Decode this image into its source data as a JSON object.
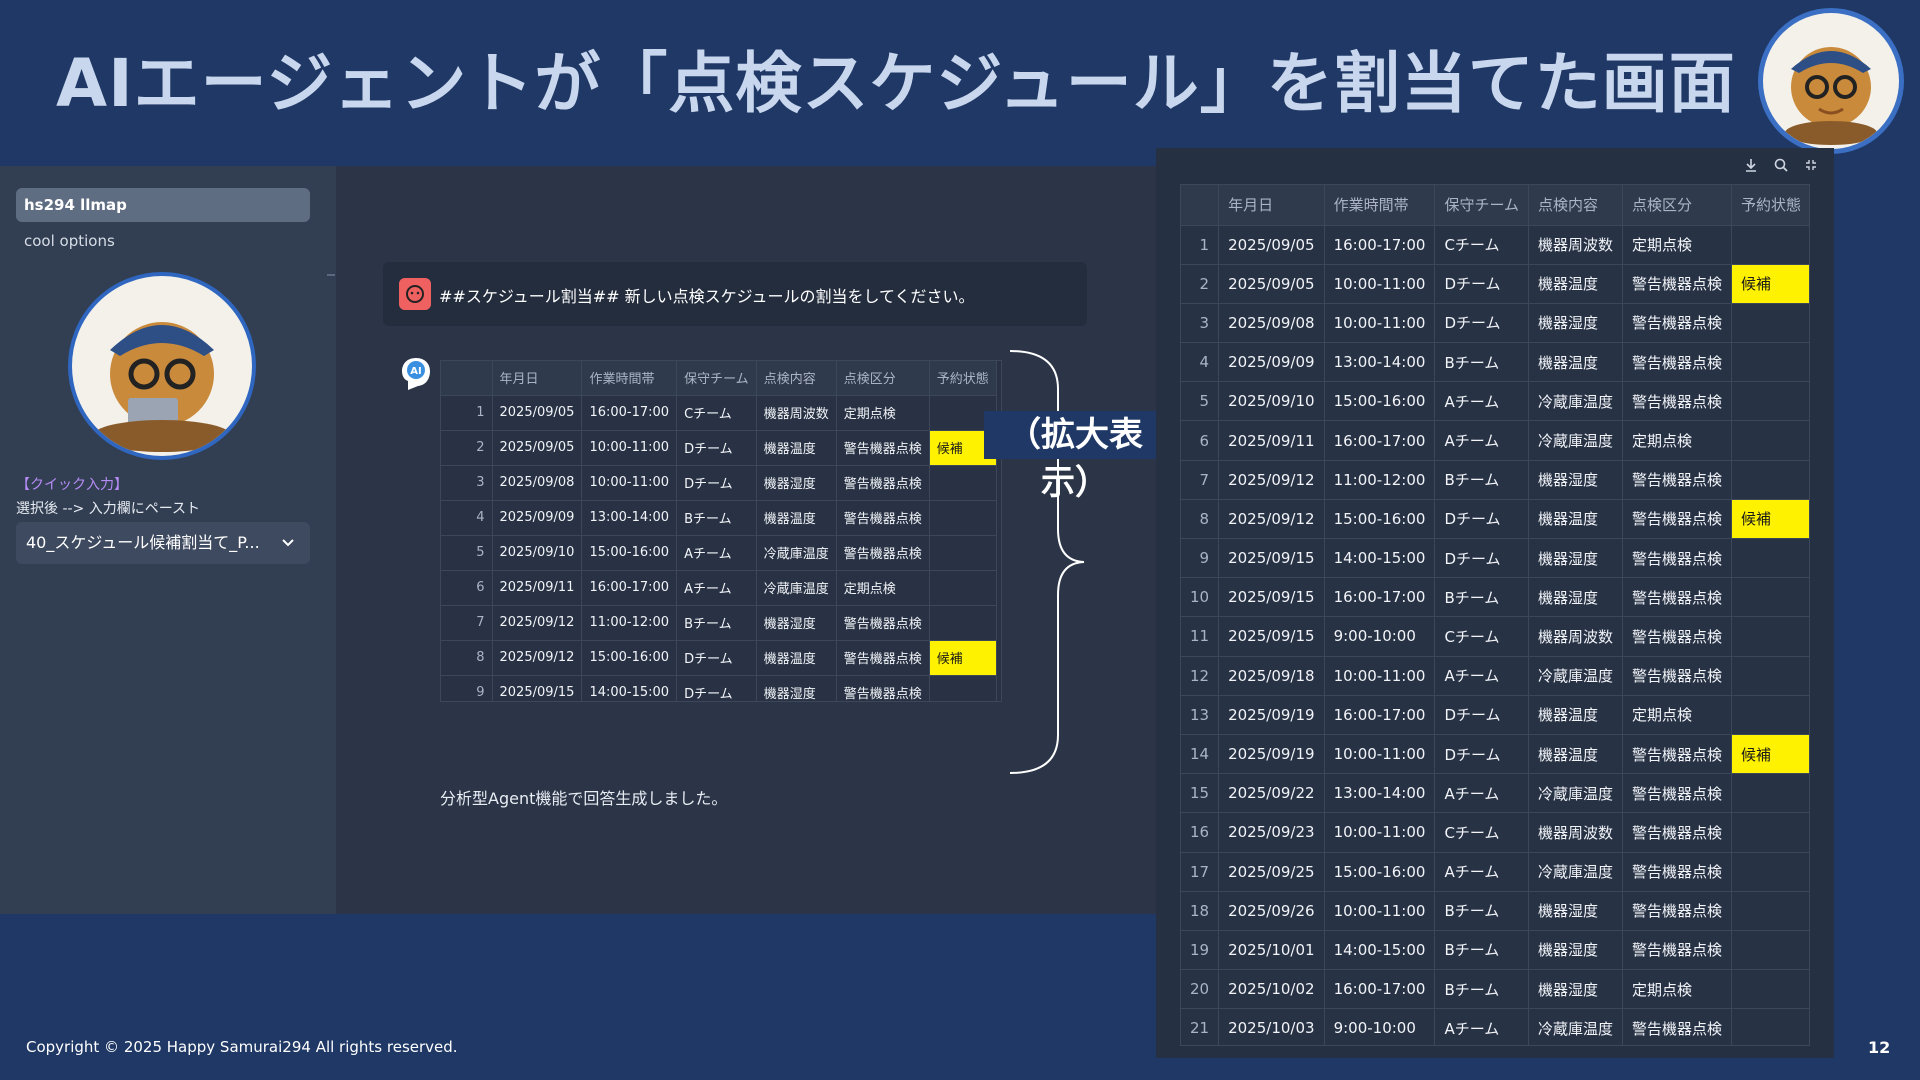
{
  "slide": {
    "title": "AIエージェントが「点検スケジュール」を割当てた画面",
    "copyright": "Copyright © 2025 Happy Samurai294 All rights reserved.",
    "page_number": "12",
    "zoom_label": "（拡大表示）"
  },
  "sidebar": {
    "model_select": "hs294 llmap",
    "options_link": "cool options",
    "quick_title": "【クイック入力】",
    "quick_hint": "選択後 --> 入力欄にペースト",
    "prompt_select": "40_スケジュール候補割当て_P..."
  },
  "chat": {
    "user_message": "##スケジュール割当## 新しい点検スケジュールの割当をしてください。",
    "ai_icon_label": "AI",
    "answer_text": "分析型Agent機能で回答生成しました。"
  },
  "table": {
    "columns": [
      "",
      "年月日",
      "作業時間帯",
      "保守チーム",
      "点検内容",
      "点検区分",
      "予約状態"
    ],
    "rows": [
      [
        "1",
        "2025/09/05",
        "16:00-17:00",
        "Cチーム",
        "機器周波数",
        "定期点検",
        ""
      ],
      [
        "2",
        "2025/09/05",
        "10:00-11:00",
        "Dチーム",
        "機器温度",
        "警告機器点検",
        "候補"
      ],
      [
        "3",
        "2025/09/08",
        "10:00-11:00",
        "Dチーム",
        "機器湿度",
        "警告機器点検",
        ""
      ],
      [
        "4",
        "2025/09/09",
        "13:00-14:00",
        "Bチーム",
        "機器温度",
        "警告機器点検",
        ""
      ],
      [
        "5",
        "2025/09/10",
        "15:00-16:00",
        "Aチーム",
        "冷蔵庫温度",
        "警告機器点検",
        ""
      ],
      [
        "6",
        "2025/09/11",
        "16:00-17:00",
        "Aチーム",
        "冷蔵庫温度",
        "定期点検",
        ""
      ],
      [
        "7",
        "2025/09/12",
        "11:00-12:00",
        "Bチーム",
        "機器湿度",
        "警告機器点検",
        ""
      ],
      [
        "8",
        "2025/09/12",
        "15:00-16:00",
        "Dチーム",
        "機器温度",
        "警告機器点検",
        "候補"
      ],
      [
        "9",
        "2025/09/15",
        "14:00-15:00",
        "Dチーム",
        "機器湿度",
        "警告機器点検",
        ""
      ],
      [
        "10",
        "2025/09/15",
        "16:00-17:00",
        "Bチーム",
        "機器湿度",
        "警告機器点検",
        ""
      ],
      [
        "11",
        "2025/09/15",
        "9:00-10:00",
        "Cチーム",
        "機器周波数",
        "警告機器点検",
        ""
      ],
      [
        "12",
        "2025/09/18",
        "10:00-11:00",
        "Aチーム",
        "冷蔵庫温度",
        "警告機器点検",
        ""
      ],
      [
        "13",
        "2025/09/19",
        "16:00-17:00",
        "Dチーム",
        "機器温度",
        "定期点検",
        ""
      ],
      [
        "14",
        "2025/09/19",
        "10:00-11:00",
        "Dチーム",
        "機器温度",
        "警告機器点検",
        "候補"
      ],
      [
        "15",
        "2025/09/22",
        "13:00-14:00",
        "Aチーム",
        "冷蔵庫温度",
        "警告機器点検",
        ""
      ],
      [
        "16",
        "2025/09/23",
        "10:00-11:00",
        "Cチーム",
        "機器周波数",
        "警告機器点検",
        ""
      ],
      [
        "17",
        "2025/09/25",
        "15:00-16:00",
        "Aチーム",
        "冷蔵庫温度",
        "警告機器点検",
        ""
      ],
      [
        "18",
        "2025/09/26",
        "10:00-11:00",
        "Bチーム",
        "機器湿度",
        "警告機器点検",
        ""
      ],
      [
        "19",
        "2025/10/01",
        "14:00-15:00",
        "Bチーム",
        "機器湿度",
        "警告機器点検",
        ""
      ],
      [
        "20",
        "2025/10/02",
        "16:00-17:00",
        "Bチーム",
        "機器湿度",
        "定期点検",
        ""
      ],
      [
        "21",
        "2025/10/03",
        "9:00-10:00",
        "Aチーム",
        "冷蔵庫温度",
        "警告機器点検",
        ""
      ]
    ],
    "mini_visible_rows": 11,
    "candidate_value": "候補"
  },
  "icons": {
    "chevron": "chevron-down-icon",
    "download": "download-icon",
    "search": "search-icon",
    "fullscreen": "fullscreen-icon",
    "user": "user-avatar-icon",
    "ai": "ai-assistant-icon"
  },
  "colors": {
    "slide_bg": "#1f3865",
    "title": "#c9d7ee",
    "candidate_highlight": "#fff200",
    "quick_title": "#b58cf5",
    "user_icon": "#ef6060"
  }
}
